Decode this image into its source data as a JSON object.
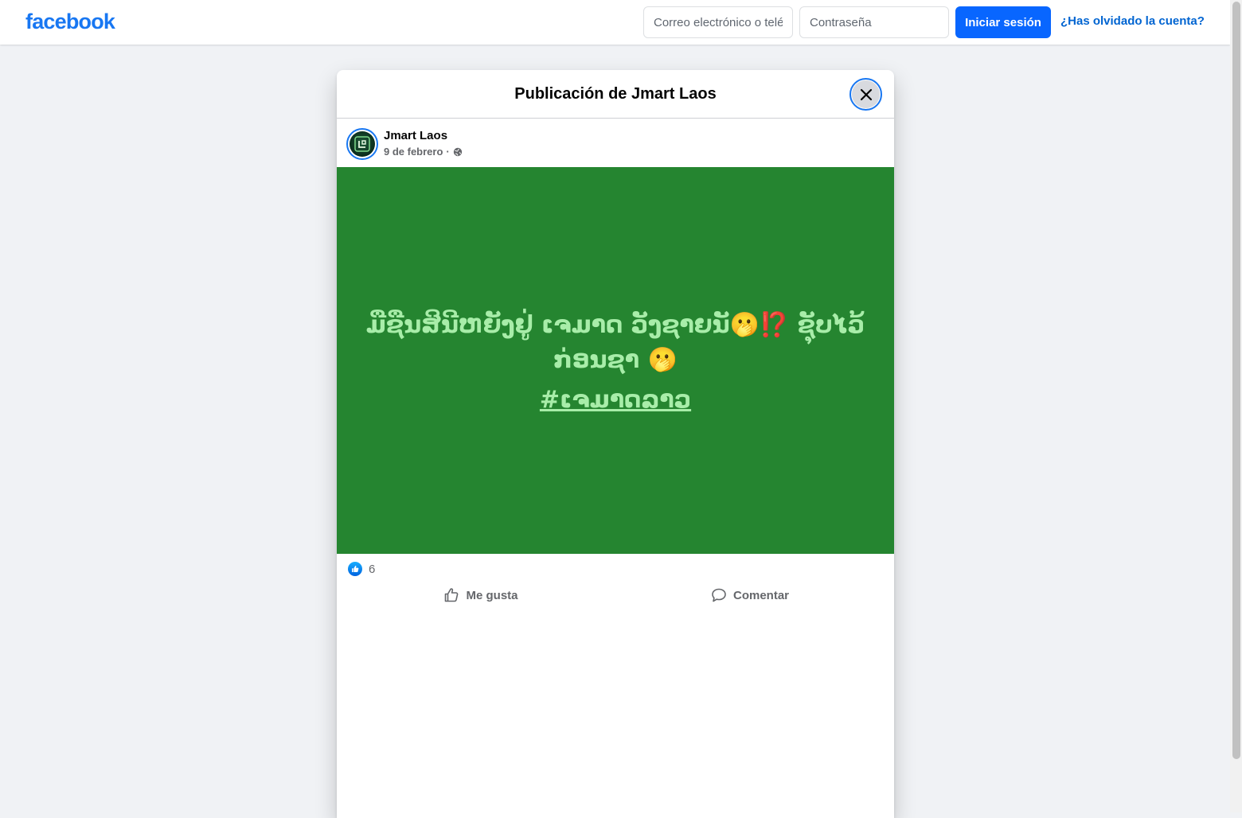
{
  "header": {
    "logo_text": "facebook",
    "email_placeholder": "Correo electrónico o teléfono",
    "password_placeholder": "Contraseña",
    "login_label": "Iniciar sesión",
    "forgot_label": "¿Has olvidado la cuenta?"
  },
  "dialog": {
    "title": "Publicación de Jmart Laos",
    "close_icon": "close-icon"
  },
  "post": {
    "author": "Jmart Laos",
    "date": "9 de febrero",
    "separator": "·",
    "audience_icon": "globe-icon",
    "background_color": "#258530",
    "text_color": "#a8eda9",
    "text": "ມືຊືນສິນີຫຍັງຢູ່ ເຈມາດ ວັງຊາຍນັ🫢⁉️ ຊຸັບໄວ້ກ່ອນຊາ 🫢",
    "hashtag": "#ເຈມາດລາວ",
    "like_count": "6",
    "actions": {
      "like_label": "Me gusta",
      "comment_label": "Comentar"
    }
  },
  "colors": {
    "brand": "#1877f2",
    "login_button": "#0866ff",
    "link": "#0064d1"
  }
}
